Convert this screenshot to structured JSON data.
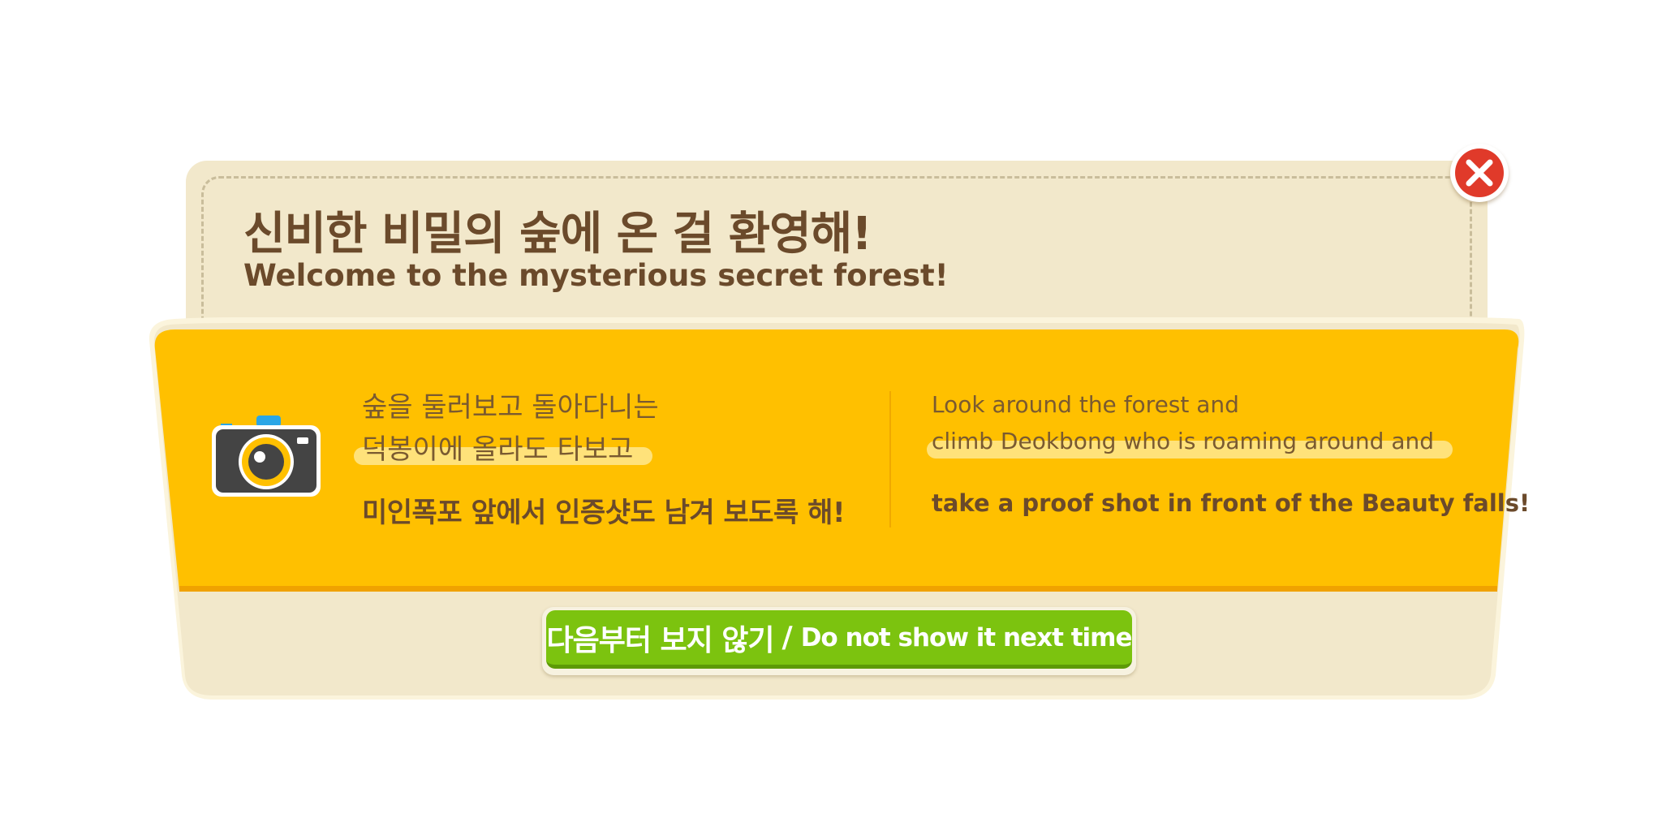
{
  "popup": {
    "title_ko": "신비한 비밀의 숲에 온 걸 환영해!",
    "title_en": "Welcome to the mysterious secret forest!",
    "icon": "camera-icon",
    "colors": {
      "cream": "#f2e8cb",
      "yellow": "#ffc000",
      "brown": "#6b4a2b",
      "green": "#7cc30f",
      "close_red": "#e03a2a"
    },
    "description_ko": {
      "line1": "숲을 둘러보고 돌아다니는",
      "line2": "덕봉이에 올라도 타보고",
      "line3": "미인폭포 앞에서 인증샷도 남겨 보도록 해!"
    },
    "description_en": {
      "line1": "Look around the forest and",
      "line2": "climb Deokbong who is roaming around and",
      "line3": "take a proof shot in front of the Beauty falls!"
    },
    "dont_show_button": {
      "label_ko": "다음부터 보지 않기",
      "separator": "/",
      "label_en": "Do not show it next time"
    },
    "close_button": {
      "icon": "close-icon"
    }
  }
}
